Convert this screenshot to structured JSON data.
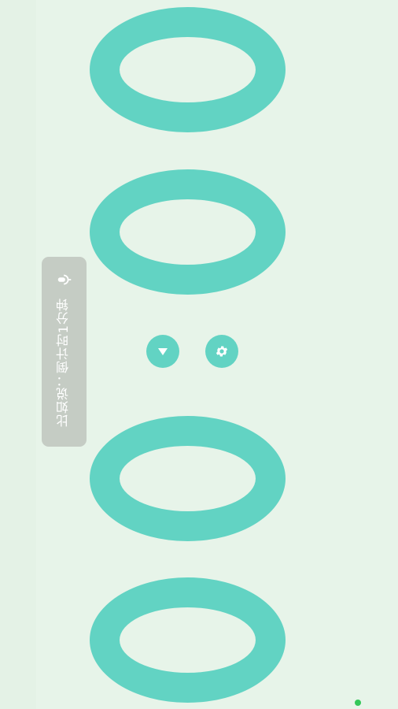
{
  "clock": {
    "digits": [
      "0",
      "0",
      "0",
      "0"
    ]
  },
  "voice_hint": {
    "text": "比如说：倒计时1分钟",
    "icon": "microphone-icon"
  },
  "controls": {
    "dropdown_icon": "triangle-down-icon",
    "settings_icon": "gear-icon"
  },
  "colors": {
    "background": "#e7f4e9",
    "digit": "#62d3c3",
    "hint_background": "#c5ccc4",
    "status_dot": "#34c759"
  }
}
